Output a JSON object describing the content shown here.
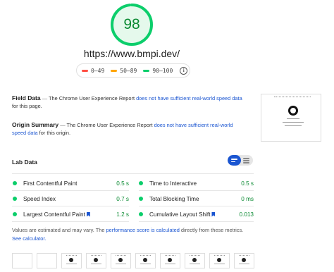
{
  "score": {
    "value": "98",
    "fraction": 0.98,
    "color": "#0cce6b"
  },
  "url": "https://www.bmpi.dev/",
  "legend": {
    "items": [
      {
        "label": "0–49",
        "color": "#ff4e42"
      },
      {
        "label": "50–89",
        "color": "#ffa400"
      },
      {
        "label": "90–100",
        "color": "#0cce6b"
      }
    ],
    "info_icon": "i"
  },
  "field_data": {
    "title": "Field Data",
    "dash": "—",
    "text_before": "The Chrome User Experience Report",
    "link": "does not have sufficient real-world speed data",
    "text_after": "for this page."
  },
  "origin_summary": {
    "title": "Origin Summary",
    "dash": "—",
    "text_before": "The Chrome User Experience Report",
    "link": "does not have sufficient real-world speed data",
    "text_after": "for this origin."
  },
  "lab_data": {
    "title": "Lab Data",
    "metrics": [
      {
        "label": "First Contentful Paint",
        "value": "0.5 s"
      },
      {
        "label": "Time to Interactive",
        "value": "0.5 s"
      },
      {
        "label": "Speed Index",
        "value": "0.7 s"
      },
      {
        "label": "Total Blocking Time",
        "value": "0 ms"
      },
      {
        "label": "Largest Contentful Paint",
        "value": "1.2 s"
      },
      {
        "label": "Cumulative Layout Shift",
        "value": "0.013"
      }
    ]
  },
  "note": {
    "text1": "Values are estimated and may vary. The",
    "link1": "performance score is calculated",
    "text2": "directly from these metrics.",
    "link2": "See calculator."
  },
  "colors": {
    "good": "#0cce6b",
    "good_text": "#0a8a32",
    "link": "#1a55d1"
  }
}
